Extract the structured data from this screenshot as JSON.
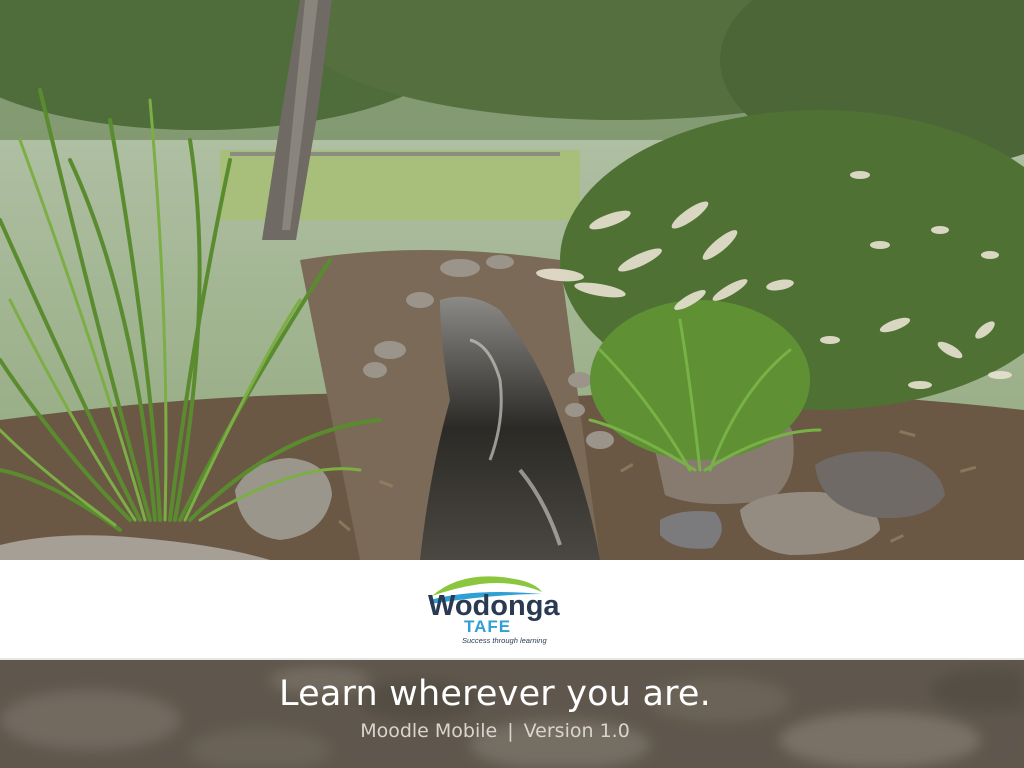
{
  "brand": {
    "name": "Wodonga",
    "subname": "TAFE",
    "tagline": "Success through learning",
    "colors": {
      "navy": "#2a3a52",
      "green": "#8cc63f",
      "blue": "#2f9fd6"
    }
  },
  "hero": {
    "icon": "creek-landscape-photo"
  },
  "footer": {
    "headline": "Learn wherever you are.",
    "app_name": "Moodle Mobile",
    "separator": "|",
    "version": "Version 1.0"
  }
}
